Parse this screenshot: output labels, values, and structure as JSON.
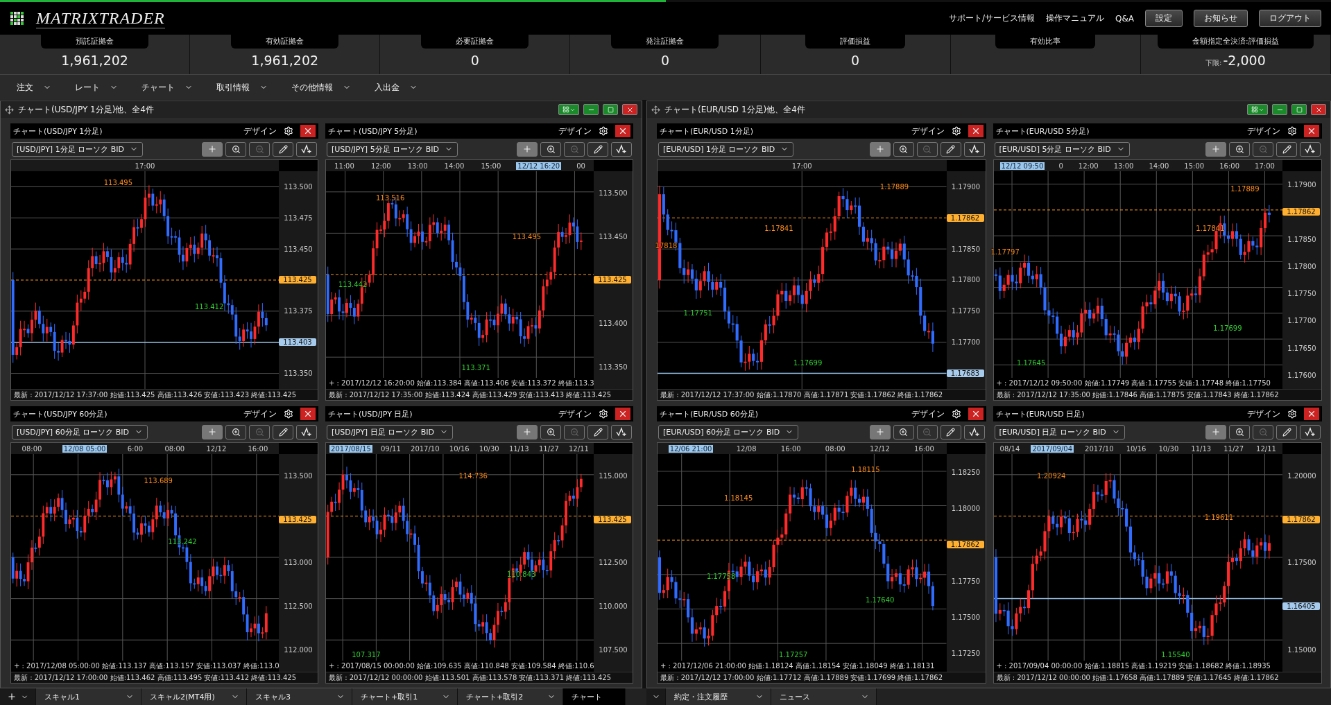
{
  "loading_bar": {
    "level": 0.5
  },
  "header": {
    "logo": "MATRIXTRADER",
    "links": [
      "サポート/サービス情報",
      "操作マニュアル",
      "Q&A"
    ],
    "buttons": [
      "設定",
      "お知らせ",
      "ログアウト"
    ]
  },
  "account": [
    {
      "label": "預託証拠金",
      "value": "1,961,202"
    },
    {
      "label": "有効証拠金",
      "value": "1,961,202"
    },
    {
      "label": "必要証拠金",
      "value": "0"
    },
    {
      "label": "発注証拠金",
      "value": "0"
    },
    {
      "label": "評価損益",
      "value": "0"
    },
    {
      "label": "有効比率"
    },
    {
      "label": "金額指定全決済:評価損益",
      "prefix": "下限:",
      "value": "-2,000"
    }
  ],
  "menu": [
    "注文",
    "レート",
    "チャート",
    "取引情報",
    "その他情報",
    "入出金"
  ],
  "windows": [
    {
      "title": "チャート(USD/JPY 1分足)他、全4件",
      "charts": [
        {
          "title": "チャート(USD/JPY 1分足)",
          "design": "デザイン",
          "selector": "[USD/JPY] 1分足 ローソク BID",
          "x_labels": [
            {
              "text": "17:00"
            }
          ],
          "y_labels": [
            "113.500",
            "113.475",
            "113.450",
            "113.375",
            "113.350"
          ],
          "tags": [
            {
              "text": "113.425",
              "kind": "current"
            },
            {
              "text": "113.403",
              "kind": "line"
            }
          ],
          "marks": [
            {
              "text": "113.495",
              "kind": "high"
            },
            {
              "text": "113.412",
              "kind": "low"
            }
          ],
          "latest": "最新 : 2017/12/12 17:37:00  始値:113.425  高値:113.426  安値:113.423  終値:113.425"
        },
        {
          "title": "チャート(USD/JPY 5分足)",
          "design": "デザイン",
          "selector": "[USD/JPY] 5分足 ローソク BID",
          "x_labels": [
            {
              "text": "11:00"
            },
            {
              "text": "12:00"
            },
            {
              "text": "13:00"
            },
            {
              "text": "14:00"
            },
            {
              "text": "15:00"
            },
            {
              "text": "12/12 16:20",
              "kind": "cursor"
            },
            {
              "text": "00"
            }
          ],
          "y_labels": [
            "113.500",
            "113.450",
            "113.400",
            "113.350"
          ],
          "tags": [
            {
              "text": "113.425",
              "kind": "current"
            }
          ],
          "marks": [
            {
              "text": "113.516",
              "kind": "high"
            },
            {
              "text": "113.495",
              "kind": "high"
            },
            {
              "text": "113.442",
              "kind": "low"
            },
            {
              "text": "113.371",
              "kind": "low"
            }
          ],
          "cursor_info": "+ : 2017/12/12 16:20:00  始値:113.384  高値:113.406  安値:113.372  終値:113.3",
          "latest": "最新 : 2017/12/12 17:35:00  始値:113.424  高値:113.429  安値:113.413  終値:113.425"
        },
        {
          "title": "チャート(USD/JPY 60分足)",
          "design": "デザイン",
          "selector": "[USD/JPY] 60分足 ローソク BID",
          "x_labels": [
            {
              "text": "08:00"
            },
            {
              "text": "12/08 05:00",
              "kind": "cursor"
            },
            {
              "text": "6:00"
            },
            {
              "text": "08:00"
            },
            {
              "text": "12/12"
            },
            {
              "text": "16:00"
            }
          ],
          "y_labels": [
            "113.500",
            "113.000",
            "112.500",
            "112.000"
          ],
          "tags": [
            {
              "text": "113.425",
              "kind": "current"
            }
          ],
          "marks": [
            {
              "text": "113.689",
              "kind": "high"
            },
            {
              "text": "113.242",
              "kind": "low"
            }
          ],
          "cursor_info": "+ : 2017/12/08 05:00:00  始値:113.137  高値:113.157  安値:113.037  終値:113.0",
          "latest": "最新 : 2017/12/12 17:00:00  始値:113.462  高値:113.495  安値:113.412  終値:113.425"
        },
        {
          "title": "チャート(USD/JPY 日足)",
          "design": "デザイン",
          "selector": "[USD/JPY] 日足 ローソク BID",
          "x_labels": [
            {
              "text": "2017/08/15",
              "kind": "cursor"
            },
            {
              "text": "09/11"
            },
            {
              "text": "2017/10"
            },
            {
              "text": "10/16"
            },
            {
              "text": "10/30"
            },
            {
              "text": "11/13"
            },
            {
              "text": "11/27"
            },
            {
              "text": "12/11"
            }
          ],
          "y_labels": [
            "115.000",
            "112.500",
            "110.000",
            "107.500"
          ],
          "tags": [
            {
              "text": "113.425",
              "kind": "current"
            }
          ],
          "marks": [
            {
              "text": "114.736",
              "kind": "high"
            },
            {
              "text": "110.843",
              "kind": "low"
            },
            {
              "text": "107.317",
              "kind": "low"
            }
          ],
          "cursor_info": "+ : 2017/08/15 00:00:00  始値:109.635  高値:110.848  安値:109.584  終値:110.6",
          "latest": "最新 : 2017/12/12 00:00:00  始値:113.501  高値:113.578  安値:113.371  終値:113.425"
        }
      ]
    },
    {
      "title": "チャート(EUR/USD 1分足)他、全4件",
      "charts": [
        {
          "title": "チャート(EUR/USD 1分足)",
          "design": "デザイン",
          "selector": "[EUR/USD] 1分足 ローソク BID",
          "x_labels": [
            {
              "text": "17:00"
            }
          ],
          "y_labels": [
            "1.17900",
            "1.17850",
            "1.17800",
            "1.17750",
            "1.17700"
          ],
          "tags": [
            {
              "text": "1.17862",
              "kind": "current"
            },
            {
              "text": "1.17683",
              "kind": "line"
            }
          ],
          "marks": [
            {
              "text": "17818",
              "kind": "high"
            },
            {
              "text": "1.17841",
              "kind": "high"
            },
            {
              "text": "1.17889",
              "kind": "high"
            },
            {
              "text": "1.17751",
              "kind": "low"
            },
            {
              "text": "1.17699",
              "kind": "low"
            }
          ],
          "latest": "最新 : 2017/12/12 17:37:00  始値:1.17870  高値:1.17871  安値:1.17862  終値:1.17862"
        },
        {
          "title": "チャート(EUR/USD 5分足)",
          "design": "デザイン",
          "selector": "[EUR/USD] 5分足 ローソク BID",
          "x_labels": [
            {
              "text": "12/12 09:50",
              "kind": "cursor"
            },
            {
              "text": "0"
            },
            {
              "text": "12:00"
            },
            {
              "text": "13:00"
            },
            {
              "text": "14:00"
            },
            {
              "text": "15:00"
            },
            {
              "text": "16:00"
            },
            {
              "text": "17:00"
            }
          ],
          "y_labels": [
            "1.17900",
            "1.17850",
            "1.17800",
            "1.17750",
            "1.17700",
            "1.17650",
            "1.17600"
          ],
          "tags": [
            {
              "text": "1.17862",
              "kind": "current"
            }
          ],
          "marks": [
            {
              "text": "1.17797",
              "kind": "high"
            },
            {
              "text": "1.17841",
              "kind": "high"
            },
            {
              "text": "1.17889",
              "kind": "high"
            },
            {
              "text": "1.17645",
              "kind": "low"
            },
            {
              "text": "1.17699",
              "kind": "low"
            }
          ],
          "cursor_info": "+ : 2017/12/12 09:50:00  始値:1.17749  高値:1.17755  安値:1.17748  終値:1.17750",
          "latest": "最新 : 2017/12/12 17:35:00  始値:1.17846  高値:1.17875  安値:1.17843  終値:1.17862"
        },
        {
          "title": "チャート(EUR/USD 60分足)",
          "design": "デザイン",
          "selector": "[EUR/USD] 60分足 ローソク BID",
          "x_labels": [
            {
              "text": "12/06 21:00",
              "kind": "cursor"
            },
            {
              "text": "12/08"
            },
            {
              "text": "16:00"
            },
            {
              "text": "08:00"
            },
            {
              "text": "12/12"
            },
            {
              "text": "16:00"
            }
          ],
          "y_labels": [
            "1.18250",
            "1.18000",
            "1.17750",
            "1.17500",
            "1.17250"
          ],
          "tags": [
            {
              "text": "1.17862",
              "kind": "current"
            }
          ],
          "marks": [
            {
              "text": "1.18145",
              "kind": "high"
            },
            {
              "text": "1.18115",
              "kind": "high"
            },
            {
              "text": "1.17758",
              "kind": "low"
            },
            {
              "text": "1.17640",
              "kind": "low"
            },
            {
              "text": "1.17257",
              "kind": "low"
            }
          ],
          "cursor_info": "+ : 2017/12/06 21:00:00  始値:1.18124  高値:1.18154  安値:1.18049  終値:1.18131",
          "latest": "最新 : 2017/12/12 17:00:00  始値:1.17712  高値:1.17889  安値:1.17699  終値:1.17862"
        },
        {
          "title": "チャート(EUR/USD 日足)",
          "design": "デザイン",
          "selector": "[EUR/USD] 日足 ローソク BID",
          "x_labels": [
            {
              "text": "08/14"
            },
            {
              "text": "2017/09/04",
              "kind": "cursor"
            },
            {
              "text": "2017/10"
            },
            {
              "text": "10/16"
            },
            {
              "text": "10/30"
            },
            {
              "text": "11/13"
            },
            {
              "text": "11/27"
            },
            {
              "text": "12/11"
            }
          ],
          "y_labels": [
            "1.20000",
            "1.17500",
            "1.15000"
          ],
          "tags": [
            {
              "text": "1.17862",
              "kind": "current"
            },
            {
              "text": "1.16405",
              "kind": "line"
            }
          ],
          "marks": [
            {
              "text": "1.20924",
              "kind": "high"
            },
            {
              "text": "1.19611",
              "kind": "high"
            },
            {
              "text": "1.15540",
              "kind": "low"
            }
          ],
          "cursor_info": "+ : 2017/09/04 00:00:00  始値:1.18815  高値:1.19219  安値:1.18682  終値:1.18935",
          "latest": "最新 : 2017/12/12 00:00:00  始値:1.17658  高値:1.17889  安値:1.17645  終値:1.17862"
        }
      ]
    }
  ],
  "bottom_tabs": [
    {
      "label": "スキャル1",
      "selected": false
    },
    {
      "label": "スキャル2(MT4用)",
      "selected": false
    },
    {
      "label": "スキャル3",
      "selected": false
    },
    {
      "label": "チャート+取引1",
      "selected": false
    },
    {
      "label": "チャート+取引2",
      "selected": false
    },
    {
      "label": "チャート",
      "selected": true
    }
  ],
  "bottom_tabs_right": [
    {
      "label": "約定・注文履歴",
      "selected": false
    },
    {
      "label": "ニュース",
      "selected": false
    }
  ]
}
